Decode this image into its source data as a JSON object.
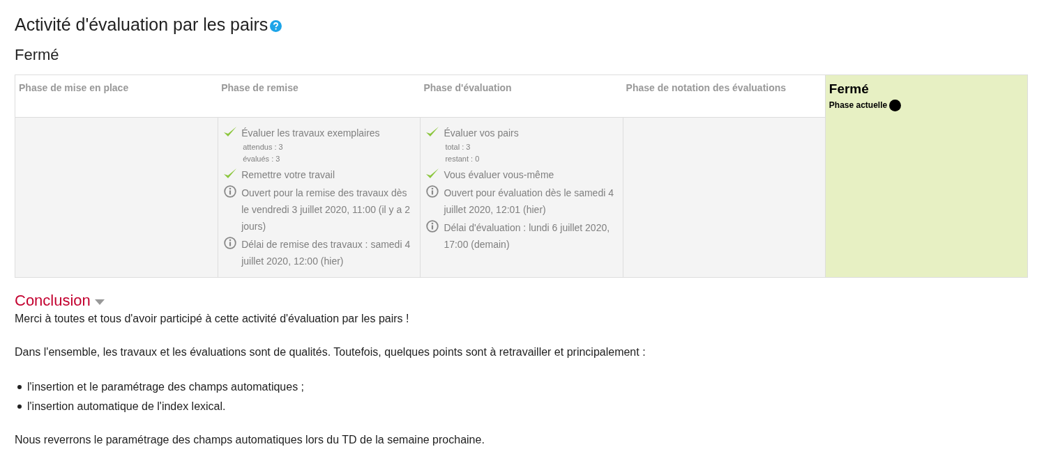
{
  "title": "Activité d'évaluation par les pairs",
  "status": "Fermé",
  "phases": [
    {
      "name": "Phase de mise en place",
      "current": false
    },
    {
      "name": "Phase de remise",
      "current": false,
      "tasks": [
        {
          "kind": "done",
          "text": "Évaluer les travaux exemplaires",
          "details": [
            "attendus : 3",
            "évalués : 3"
          ]
        },
        {
          "kind": "done",
          "text": "Remettre votre travail"
        },
        {
          "kind": "info",
          "text": "Ouvert pour la remise des travaux dès le vendredi 3 juillet 2020, 11:00 (il y a 2 jours)"
        },
        {
          "kind": "info",
          "text": "Délai de remise des travaux : samedi 4 juillet 2020, 12:00 (hier)"
        }
      ]
    },
    {
      "name": "Phase d'évaluation",
      "current": false,
      "tasks": [
        {
          "kind": "done",
          "text": "Évaluer vos pairs",
          "details": [
            "total : 3",
            "restant : 0"
          ]
        },
        {
          "kind": "done",
          "text": "Vous évaluer vous-même"
        },
        {
          "kind": "info",
          "text": "Ouvert pour évaluation dès le samedi 4 juillet 2020, 12:01 (hier)"
        },
        {
          "kind": "info",
          "text": "Délai d'évaluation : lundi 6 juillet 2020, 17:00 (demain)"
        }
      ]
    },
    {
      "name": "Phase de notation des évaluations",
      "current": false
    },
    {
      "name": "Fermé",
      "current": true,
      "current_label": "Phase actuelle"
    }
  ],
  "conclusion": {
    "heading": "Conclusion",
    "expanded": true,
    "paragraphs": [
      "Merci à toutes et tous d'avoir participé à cette activité d'évaluation par les pairs !",
      "Dans l'ensemble, les travaux et les évaluations sont de qualités. Toutefois, quelques points sont à retravailler et principalement :"
    ],
    "bullets": [
      "l'insertion et le paramétrage des champs automatiques ;",
      "l'insertion automatique de l'index lexical."
    ],
    "closing": "Nous reverrons le paramétrage des champs automatiques lors du TD de la semaine prochaine."
  }
}
